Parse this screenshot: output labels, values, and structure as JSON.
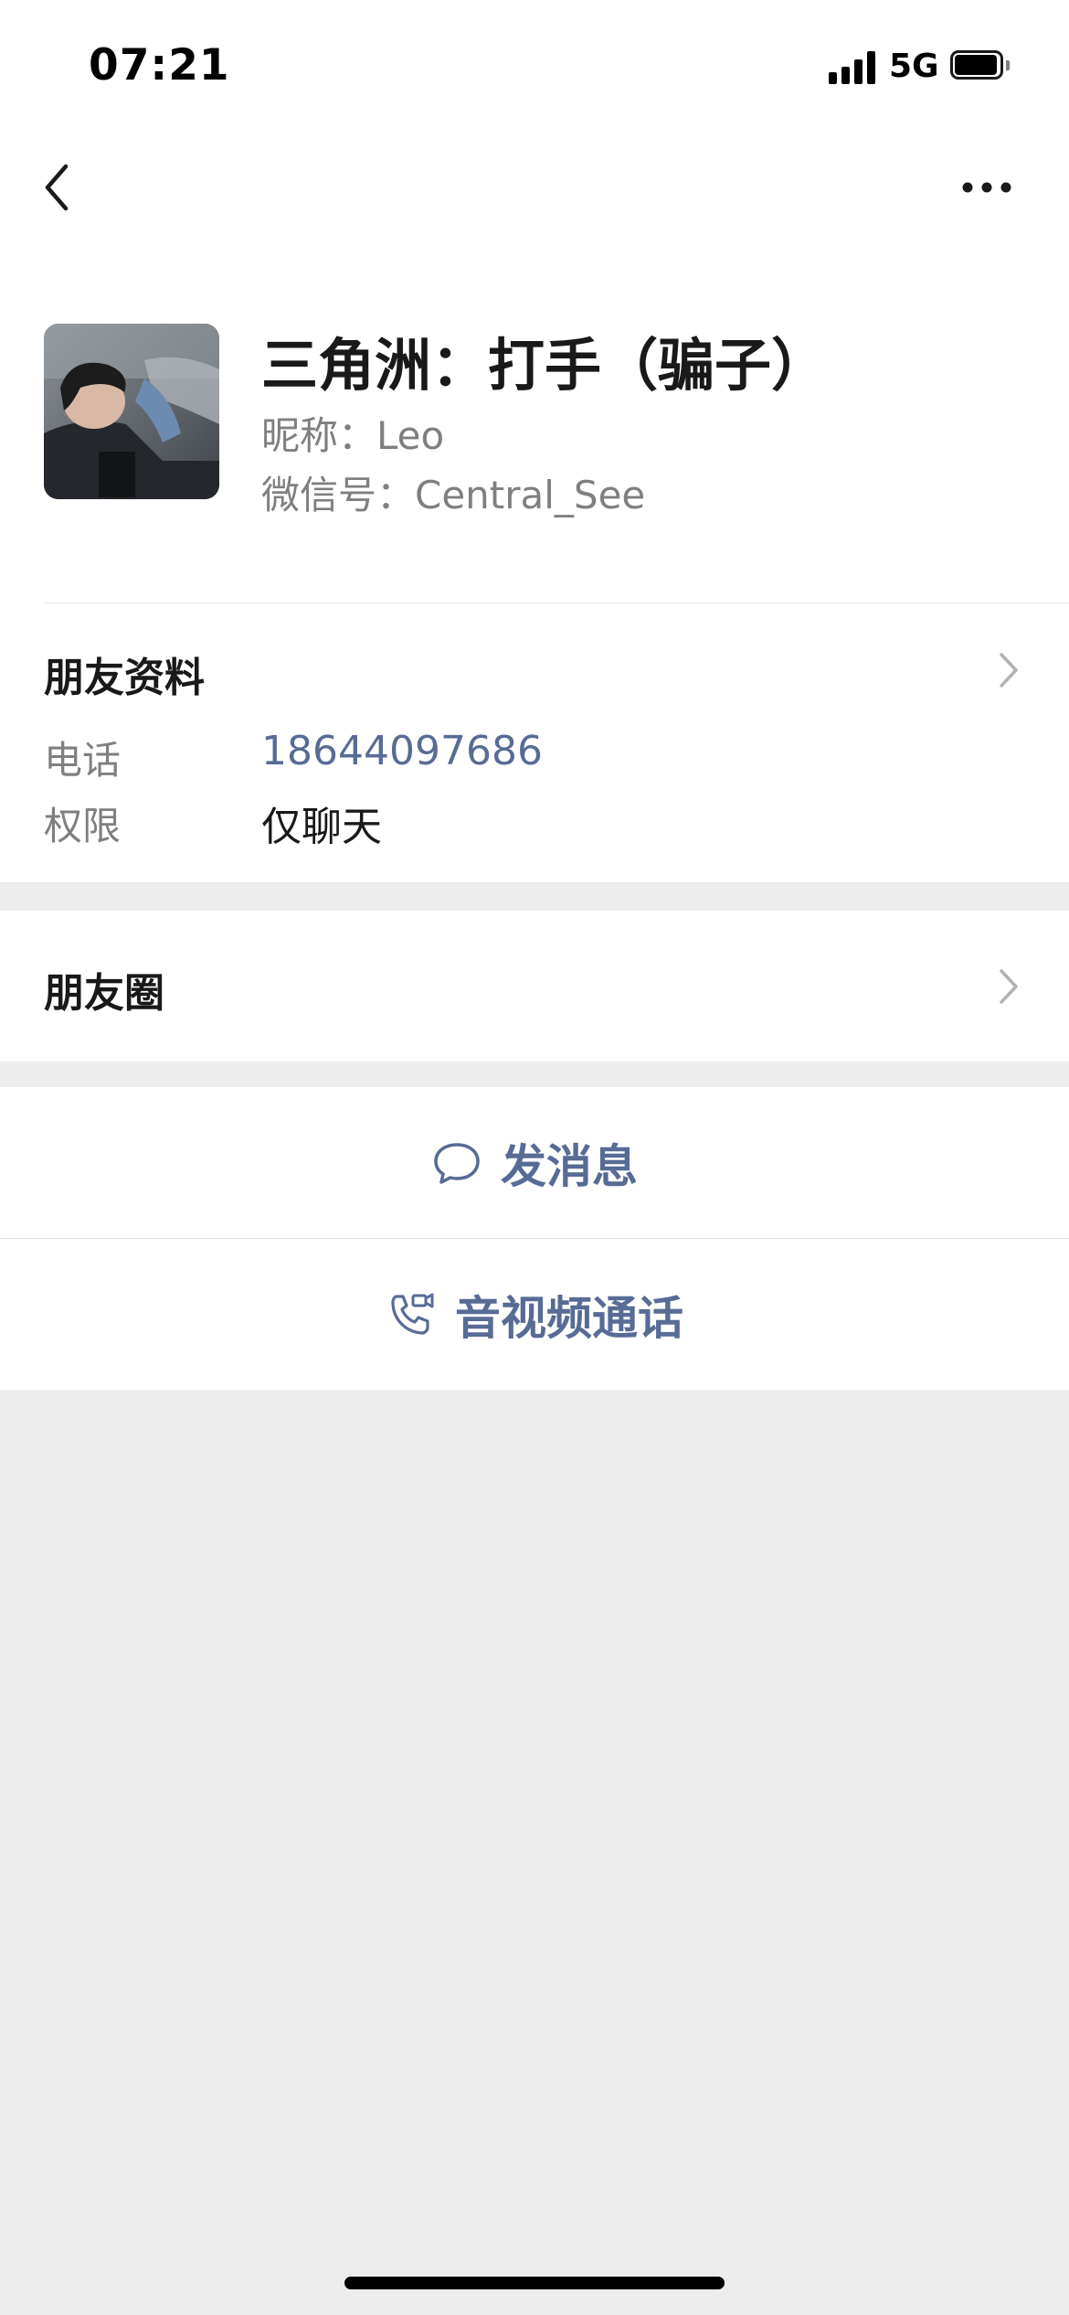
{
  "status_bar": {
    "time": "07:21",
    "network": "5G",
    "battery_level": 0.95
  },
  "nav": {
    "back_icon": "chevron-left-icon",
    "more_icon": "more-horizontal-icon"
  },
  "profile": {
    "display_name": "三角洲：打手（骗子）",
    "nickname": "昵称：Leo",
    "wechat_id": "微信号：Central_See"
  },
  "friend_info": {
    "title": "朋友资料",
    "phone_label": "电话",
    "phone_value": "18644097686",
    "permission_label": "权限",
    "permission_value": "仅聊天"
  },
  "moments": {
    "title": "朋友圈"
  },
  "actions": {
    "send_message": "发消息",
    "av_call": "音视频通话"
  },
  "colors": {
    "link_blue": "#576b95",
    "background": "#ededed",
    "card": "#ffffff"
  }
}
